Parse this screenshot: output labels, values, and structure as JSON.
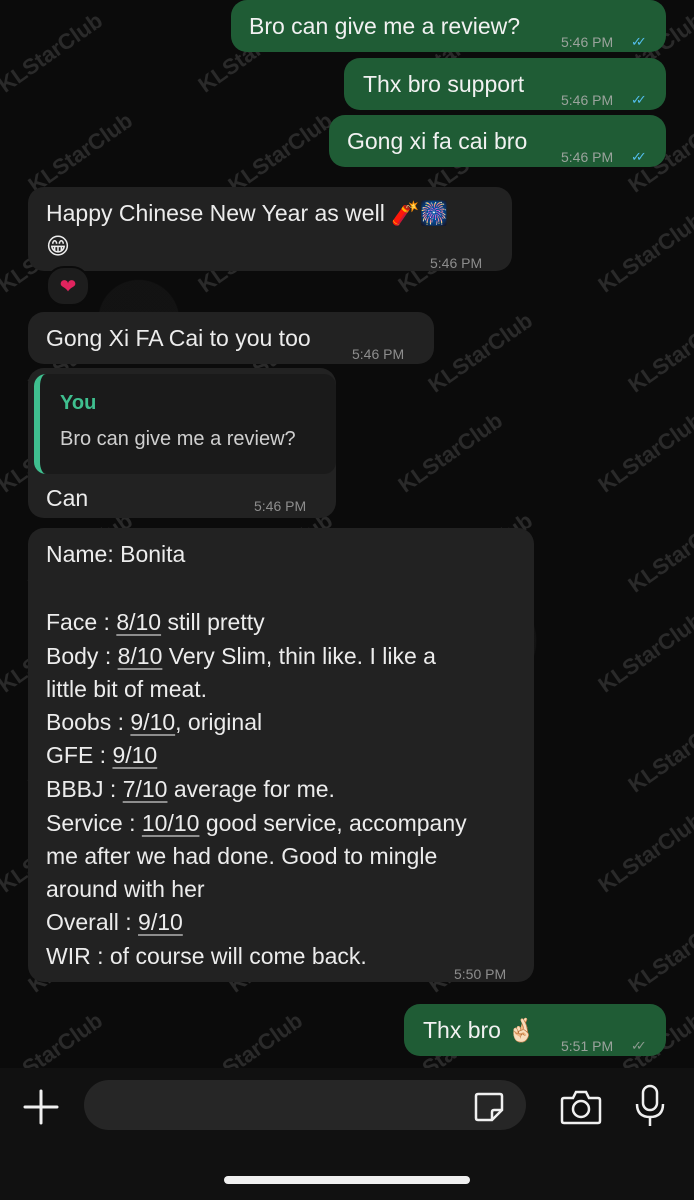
{
  "watermark": "KLStarClub",
  "messages": {
    "m1": {
      "text": "Bro can give me a review?",
      "time": "5:46 PM"
    },
    "m2": {
      "text": "Thx bro support",
      "time": "5:46 PM"
    },
    "m3": {
      "text": "Gong xi fa cai bro",
      "time": "5:46 PM"
    },
    "m4": {
      "line1": "Happy Chinese New Year as well 🧨🎆",
      "line2": "😁",
      "time": "5:46 PM",
      "reaction": "❤"
    },
    "m5": {
      "text": "Gong Xi FA Cai to you too",
      "time": "5:46 PM"
    },
    "m6": {
      "quote_author": "You",
      "quote_text": "Bro can give me a review?",
      "text": "Can",
      "time": "5:46 PM"
    },
    "m7": {
      "time": "5:50 PM",
      "name": "Name: Bonita",
      "face_label": "Face : ",
      "face_score": "8/10",
      "face_note": " still pretty",
      "body_label": "Body : ",
      "body_score": "8/10",
      "body_note": " Very Slim, thin like. I like a",
      "body_note2": "little bit of meat.",
      "boobs_label": "Boobs : ",
      "boobs_score": "9/10",
      "boobs_note": ", original",
      "gfe_label": "GFE : ",
      "gfe_score": "9/10",
      "bbbj_label": "BBBJ : ",
      "bbbj_score": "7/10",
      "bbbj_note": " average for me.",
      "service_label": "Service : ",
      "service_score": "10/10",
      "service_note": " good service, accompany",
      "service_note2": "me after we had done. Good to mingle",
      "service_note3": "around with her",
      "overall_label": "Overall : ",
      "overall_score": "9/10",
      "wir": "WIR : of course will come back."
    },
    "m8": {
      "text": "Thx bro 🤞🏻",
      "time": "5:51 PM"
    }
  },
  "ticks": "✓✓"
}
